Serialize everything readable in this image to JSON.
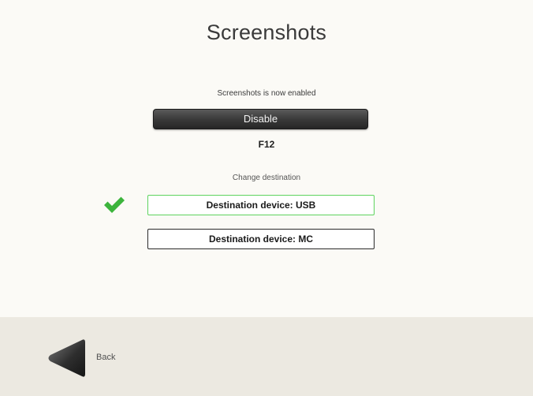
{
  "page": {
    "title": "Screenshots"
  },
  "screenshots": {
    "status_text": "Screenshots is now enabled",
    "disable_label": "Disable",
    "hotkey": "F12"
  },
  "destination": {
    "section_label": "Change destination",
    "selected_icon": "checkmark-icon",
    "options": [
      {
        "label": "Destination device: USB",
        "selected": true
      },
      {
        "label": "Destination device: MC",
        "selected": false
      }
    ],
    "selected_color": "#5ed35e"
  },
  "footer": {
    "back_label": "Back",
    "back_icon": "back-arrow-icon"
  }
}
